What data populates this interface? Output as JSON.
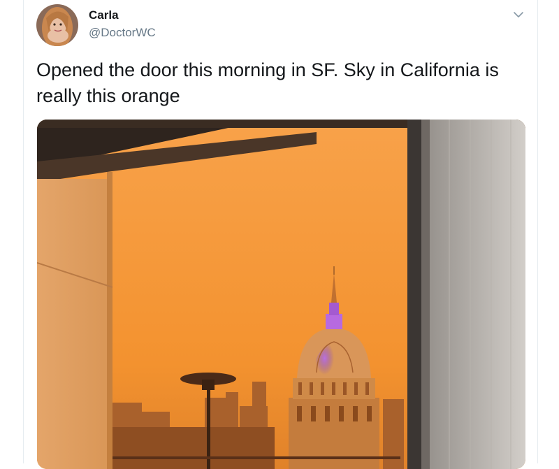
{
  "tweet": {
    "display_name": "Carla",
    "handle": "@DoctorWC",
    "text": "Opened the door this morning in SF. Sky in California is really this orange"
  },
  "icons": {
    "menu": "chevron-down-icon"
  },
  "colors": {
    "sky": "#f59a3a",
    "dome_light": "#9a5cd6",
    "text": "#14171a",
    "secondary_text": "#657786"
  }
}
